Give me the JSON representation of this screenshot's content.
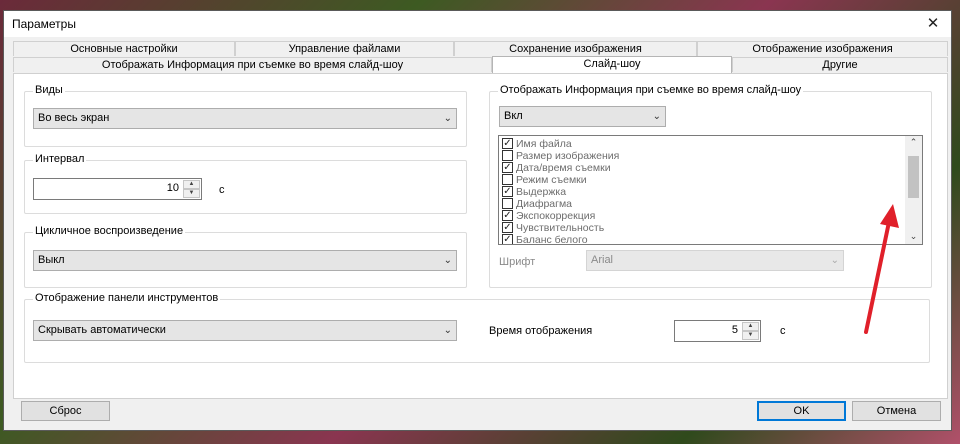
{
  "window": {
    "title": "Параметры",
    "close_glyph": "✕"
  },
  "tabs_top": [
    "Основные настройки",
    "Управление файлами",
    "Сохранение изображения",
    "Отображение изображения"
  ],
  "tabs_bottom": [
    "Отображать Информация при съемке во время слайд-шоу",
    "Слайд-шоу",
    "Другие"
  ],
  "active_tab": "Слайд-шоу",
  "views": {
    "label": "Виды",
    "value": "Во весь экран"
  },
  "interval": {
    "label": "Интервал",
    "value": "10",
    "unit": "с"
  },
  "loop": {
    "label": "Цикличное воспроизведение",
    "value": "Выкл"
  },
  "toolbar_display": {
    "label": "Отображение панели инструментов",
    "value": "Скрывать автоматически",
    "time_label": "Время отображения",
    "time_value": "5",
    "time_unit": "с"
  },
  "info_display": {
    "label": "Отображать Информация при съемке во время слайд-шоу",
    "value": "Вкл",
    "items": [
      {
        "label": "Имя файла",
        "checked": true
      },
      {
        "label": "Размер изображения",
        "checked": false
      },
      {
        "label": "Дата/время съемки",
        "checked": true
      },
      {
        "label": "Режим съемки",
        "checked": false
      },
      {
        "label": "Выдержка",
        "checked": true
      },
      {
        "label": "Диафрагма",
        "checked": false
      },
      {
        "label": "Экспокоррекция",
        "checked": true
      },
      {
        "label": "Чувствительность",
        "checked": true
      },
      {
        "label": "Баланс белого",
        "checked": true
      }
    ],
    "font_label": "Шрифт",
    "font_value": "Arial"
  },
  "buttons": {
    "reset": "Сброс",
    "ok": "OK",
    "cancel": "Отмена"
  },
  "colors": {
    "annotation_arrow": "#e0202a",
    "default_button_border": "#0078d7"
  }
}
